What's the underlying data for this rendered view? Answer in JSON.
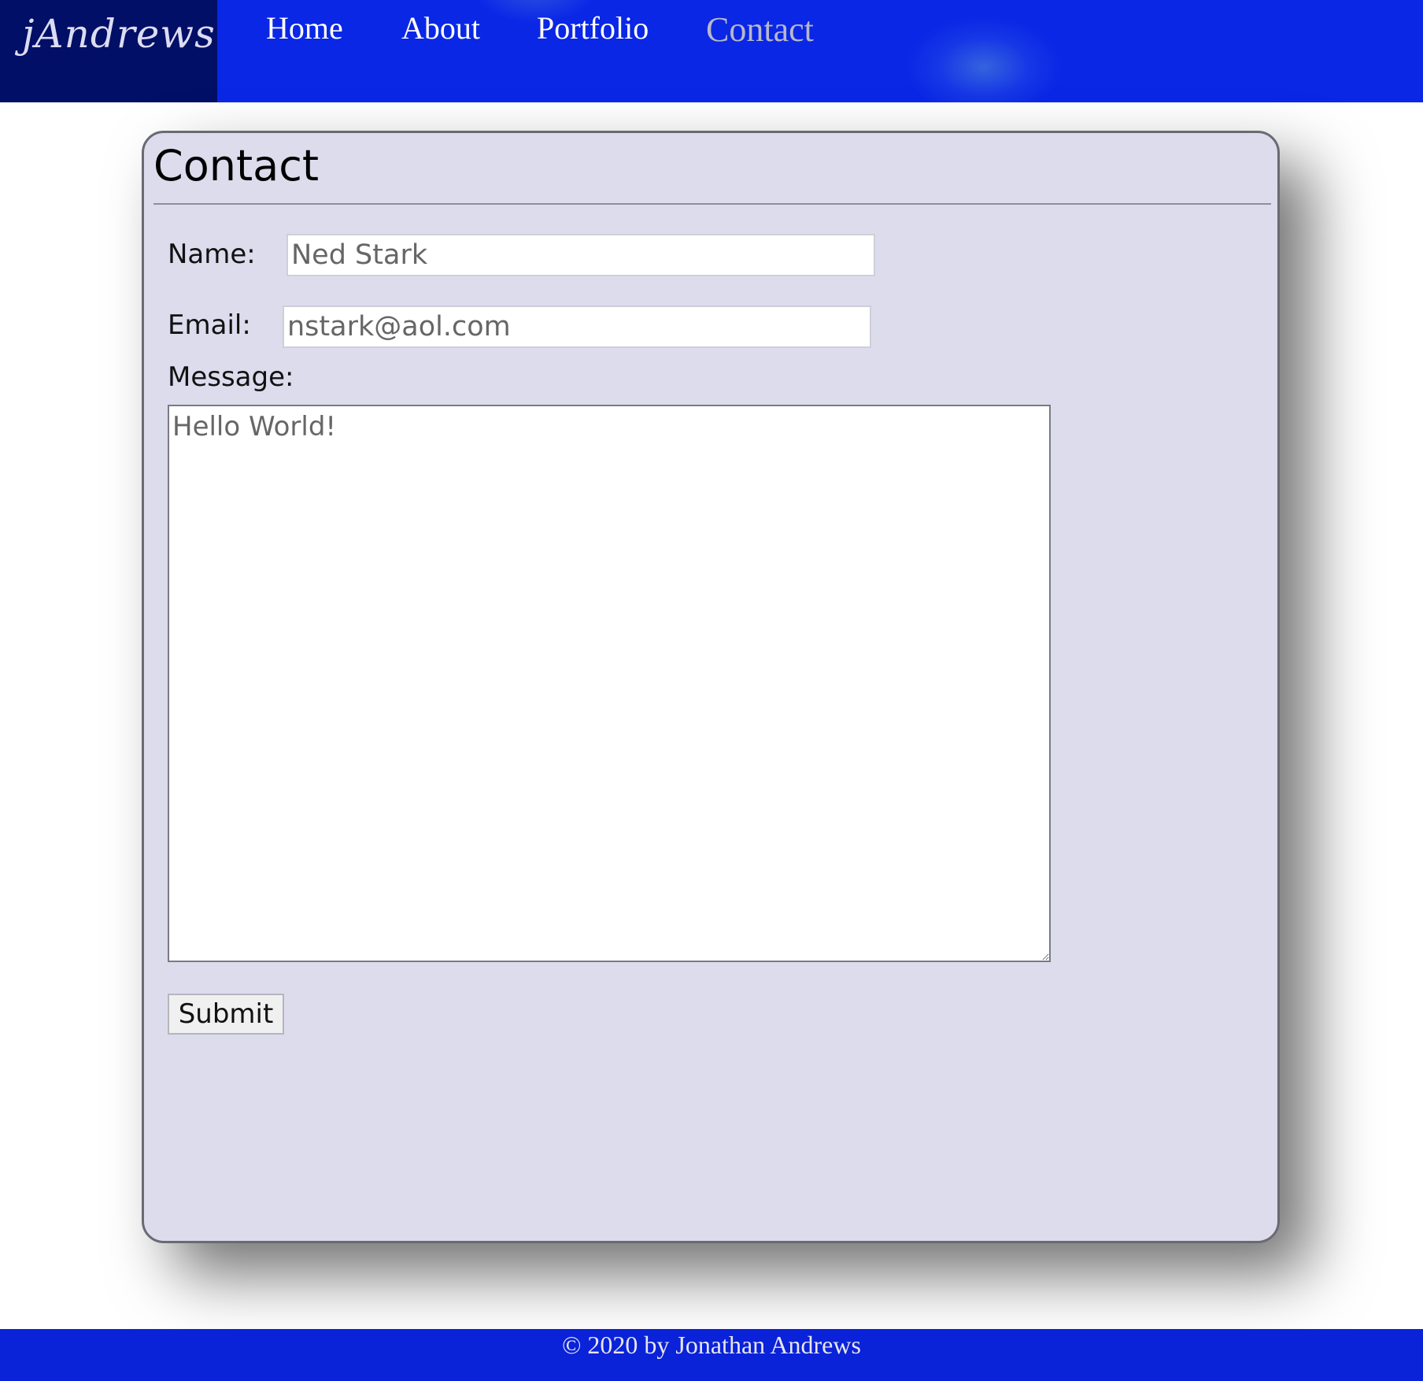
{
  "brand": {
    "logo_text": "jAndrews"
  },
  "nav": {
    "items": [
      {
        "label": "Home"
      },
      {
        "label": "About"
      },
      {
        "label": "Portfolio"
      },
      {
        "label": "Contact",
        "active": true
      }
    ]
  },
  "contact_form": {
    "title": "Contact",
    "name_label": "Name:",
    "name_value": "Ned Stark",
    "email_label": "Email:",
    "email_value": "nstark@aol.com",
    "message_label": "Message:",
    "message_value": "Hello World!",
    "submit_label": "Submit"
  },
  "footer": {
    "copyright": "© 2020 by Jonathan Andrews"
  },
  "colors": {
    "header_bg": "#0a27e6",
    "logo_bg": "#020f66",
    "card_bg": "#dcdced",
    "footer_bg": "#0a22d8",
    "active_nav": "#b8b8c8"
  }
}
